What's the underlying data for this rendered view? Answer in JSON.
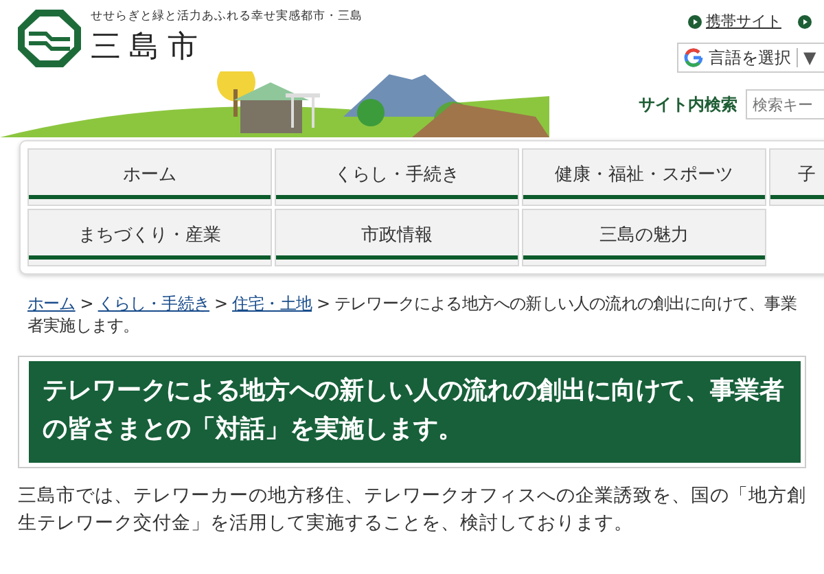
{
  "header": {
    "tagline": "せせらぎと緑と活力あふれる幸せ実感都市・三島",
    "site_name": "三島市",
    "links": [
      {
        "label": "携帯サイト"
      }
    ],
    "translate": {
      "label": "言語を選択",
      "caret": "▼"
    },
    "search": {
      "label": "サイト内検索",
      "placeholder": "検索キー"
    }
  },
  "nav": [
    {
      "label": "ホーム"
    },
    {
      "label": "くらし・手続き"
    },
    {
      "label": "健康・福祉・スポーツ"
    },
    {
      "label": "子"
    },
    {
      "label": "まちづくり・産業"
    },
    {
      "label": "市政情報"
    },
    {
      "label": "三島の魅力"
    }
  ],
  "breadcrumb": {
    "links": [
      "ホーム",
      "くらし・手続き",
      "住宅・土地"
    ],
    "separator": ">",
    "current": "テレワークによる地方への新しい人の流れの創出に向けて、事業者実施します。"
  },
  "title": "テレワークによる地方への新しい人の流れの創出に向けて、事業者の皆さまとの「対話」を実施します。",
  "body": "三島市では、テレワーカーの地方移住、テレワークオフィスへの企業誘致を、国の「地方創生テレワーク交付金」を活用して実施することを、検討しております。"
}
